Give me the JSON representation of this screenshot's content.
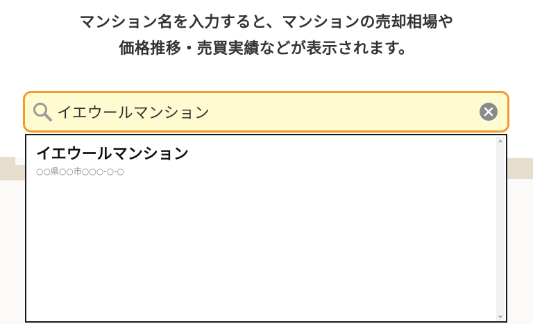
{
  "headline": {
    "line1": "マンション名を入力すると、マンションの売却相場や",
    "line2": "価格推移・売買実績などが表示されます。"
  },
  "search": {
    "value": "イエウールマンション",
    "placeholder": "",
    "icon": "search-icon",
    "clear_icon": "clear-icon"
  },
  "suggestions": [
    {
      "name": "イエウールマンション",
      "address": "○○県○○市○○○-○-○"
    }
  ],
  "colors": {
    "accent_border": "#f29a2e",
    "input_background": "#fefbd0",
    "text": "#333333"
  }
}
